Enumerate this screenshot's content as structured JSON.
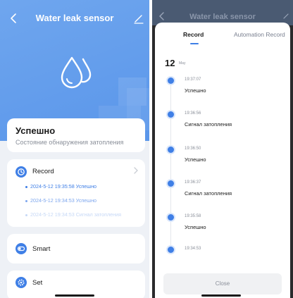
{
  "colors": {
    "accent": "#3f7fe6",
    "hero_top": "#6fa6ee",
    "hero_bottom": "#5a96ea",
    "page_bg": "#eef1f6",
    "overlay": "#2a2a2c"
  },
  "left": {
    "header": {
      "back_icon": "back-chevron-icon",
      "title": "Water leak sensor",
      "edit_icon": "edit-pencil-icon"
    },
    "hero_icon": "water-drops-icon",
    "status": {
      "title": "Успешно",
      "subtitle": "Состояние обнаружения затопления"
    },
    "record": {
      "icon": "clock-icon",
      "label": "Record",
      "chevron_icon": "chevron-right-icon",
      "items": [
        "2024-5-12 19:35:58 Успешно",
        "2024-5-12 19:34:53 Успешно",
        "2024-5-12 19:34:53 Сигнал затопления"
      ]
    },
    "smart": {
      "icon": "toggle-icon",
      "label": "Smart"
    },
    "set": {
      "icon": "gear-icon",
      "label": "Set"
    }
  },
  "right": {
    "header": {
      "back_icon": "back-chevron-icon",
      "title": "Water leak sensor",
      "edit_icon": "edit-pencil-icon"
    },
    "tabs": [
      {
        "label": "Record",
        "active": true
      },
      {
        "label": "Automation Record",
        "active": false
      }
    ],
    "date": {
      "day": "12",
      "month": "May"
    },
    "timeline": [
      {
        "time": "19:37:07",
        "text": "Успешно"
      },
      {
        "time": "19:36:56",
        "text": "Сигнал затопления"
      },
      {
        "time": "19:36:50",
        "text": "Успешно"
      },
      {
        "time": "19:36:37",
        "text": "Сигнал затопления"
      },
      {
        "time": "19:35:58",
        "text": "Успешно"
      },
      {
        "time": "19:34:53",
        "text": ""
      }
    ],
    "close_label": "Close"
  }
}
